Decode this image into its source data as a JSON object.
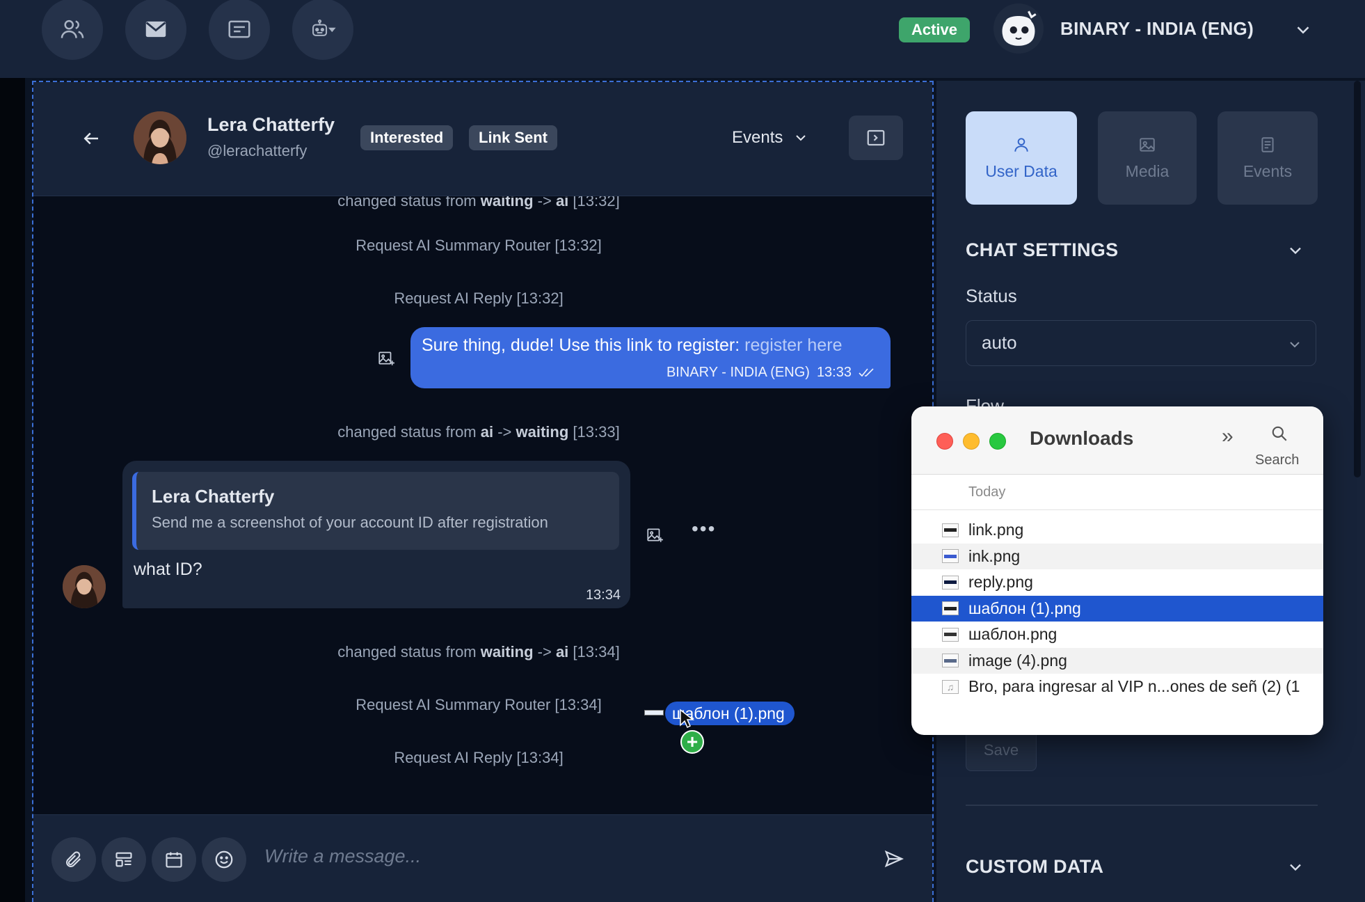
{
  "topbar": {
    "nav": [
      {
        "name": "contacts-nav-button",
        "icon": "users-icon"
      },
      {
        "name": "inbox-nav-button",
        "icon": "mail-icon"
      },
      {
        "name": "templates-nav-button",
        "icon": "message-card-icon"
      },
      {
        "name": "bot-nav-button",
        "icon": "robot-icon"
      }
    ],
    "status_badge": "Active",
    "account_name": "BINARY - INDIA (ENG)"
  },
  "chat": {
    "contact_name": "Lera Chatterfy",
    "contact_handle": "@lerachatterfy",
    "tags": [
      "Interested",
      "Link Sent"
    ],
    "events_dropdown": "Events",
    "messages": {
      "sys_top_partial": {
        "prefix": "changed status from ",
        "from": "waiting",
        "arrow": " -> ",
        "to": "ai",
        "time": " [13:32]"
      },
      "sys1": "Request AI Summary Router [13:32]",
      "sys2": "Request AI Reply [13:32]",
      "outgoing": {
        "text": "Sure thing, dude! Use this link to register: ",
        "link": "register here",
        "sender": "BINARY - INDIA (ENG)",
        "time": "13:33"
      },
      "sys3": {
        "prefix": "changed status from ",
        "from": "ai",
        "arrow": " -> ",
        "to": "waiting",
        "time": " [13:33]"
      },
      "incoming": {
        "quote_name": "Lera Chatterfy",
        "quote_text": "Send me a screenshot of your account ID after registration",
        "text": "what ID?",
        "time": "13:34"
      },
      "sys4": {
        "prefix": "changed status from ",
        "from": "waiting",
        "arrow": " -> ",
        "to": "ai",
        "time": " [13:34]"
      },
      "sys5": "Request AI Summary Router [13:34]",
      "sys6": "Request AI Reply [13:34]"
    },
    "drag_file_label": "шаблон (1).png",
    "composer_placeholder": "Write a message..."
  },
  "sidebar": {
    "tabs": [
      {
        "label": "User Data",
        "icon": "user-icon",
        "active": true
      },
      {
        "label": "Media",
        "icon": "image-icon",
        "active": false
      },
      {
        "label": "Events",
        "icon": "document-icon",
        "active": false
      }
    ],
    "chat_settings_title": "CHAT SETTINGS",
    "status_label": "Status",
    "status_value": "auto",
    "flow_label": "Flow",
    "save_label": "Save",
    "custom_data_title": "CUSTOM DATA"
  },
  "finder": {
    "title": "Downloads",
    "search_label": "Search",
    "group_label": "Today",
    "files": [
      {
        "name": "link.png",
        "kind": "image",
        "selected": false
      },
      {
        "name": "ink.png",
        "kind": "image",
        "selected": false
      },
      {
        "name": "reply.png",
        "kind": "image",
        "selected": false
      },
      {
        "name": "шаблон (1).png",
        "kind": "image",
        "selected": true
      },
      {
        "name": "шаблон.png",
        "kind": "image",
        "selected": false
      },
      {
        "name": "image (4).png",
        "kind": "image",
        "selected": false
      },
      {
        "name": "Bro, para ingresar al VIP n...ones de señ (2) (1",
        "kind": "audio",
        "selected": false
      }
    ]
  },
  "colors": {
    "accent": "#3b6be0",
    "active_badge": "#3ea56b",
    "selection": "#1f56cf",
    "background": "#0b1424"
  }
}
